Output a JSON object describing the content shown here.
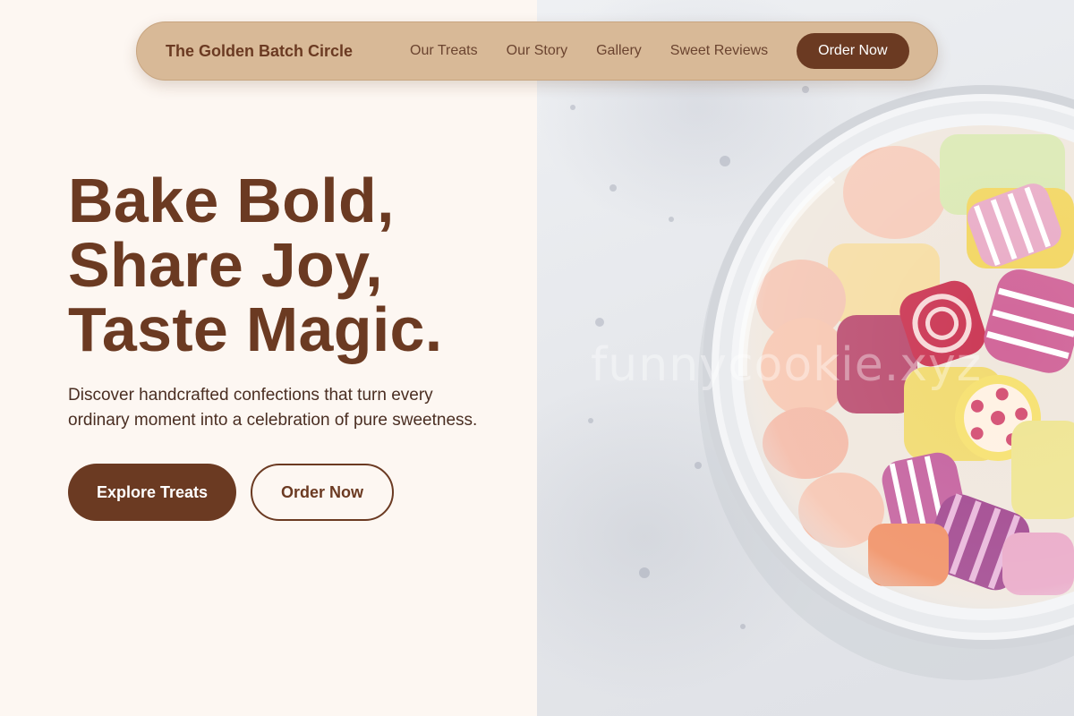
{
  "nav": {
    "brand": "The Golden Batch Circle",
    "links": [
      "Our Treats",
      "Our Story",
      "Gallery",
      "Sweet Reviews"
    ],
    "cta_label": "Order Now"
  },
  "hero": {
    "headline_lines": [
      "Bake Bold,",
      "Share Joy,",
      "Taste Magic."
    ],
    "subtext": "Discover handcrafted confections that turn every ordinary moment into a celebration of pure sweetness.",
    "primary_button": "Explore Treats",
    "secondary_button": "Order Now"
  },
  "image": {
    "subject": "glass-jar-of-candies",
    "watermark": "funnycookie.xyz"
  },
  "colors": {
    "brand_brown": "#6b3a22",
    "nav_background": "#d8b997",
    "page_background": "#fdf7f2",
    "text_dark": "#4a2e22"
  }
}
